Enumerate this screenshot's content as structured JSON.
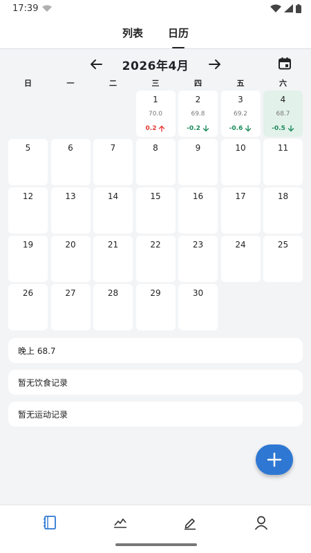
{
  "status_bar": {
    "time": "17:39"
  },
  "tabs": [
    {
      "label": "列表"
    },
    {
      "label": "日历"
    }
  ],
  "month_header": {
    "title": "2026年4月"
  },
  "weekdays": [
    "日",
    "一",
    "二",
    "三",
    "四",
    "五",
    "六"
  ],
  "calendar": {
    "leading_empty": 3,
    "days": [
      {
        "day": "1",
        "weight": "70.0",
        "delta": "0.2",
        "dir": "up"
      },
      {
        "day": "2",
        "weight": "69.8",
        "delta": "-0.2",
        "dir": "down"
      },
      {
        "day": "3",
        "weight": "69.2",
        "delta": "-0.6",
        "dir": "down"
      },
      {
        "day": "4",
        "weight": "68.7",
        "delta": "-0.5",
        "dir": "down",
        "selected": true
      },
      {
        "day": "5"
      },
      {
        "day": "6"
      },
      {
        "day": "7"
      },
      {
        "day": "8"
      },
      {
        "day": "9"
      },
      {
        "day": "10"
      },
      {
        "day": "11"
      },
      {
        "day": "12"
      },
      {
        "day": "13"
      },
      {
        "day": "14"
      },
      {
        "day": "15"
      },
      {
        "day": "16"
      },
      {
        "day": "17"
      },
      {
        "day": "18"
      },
      {
        "day": "19"
      },
      {
        "day": "20"
      },
      {
        "day": "21"
      },
      {
        "day": "22"
      },
      {
        "day": "23"
      },
      {
        "day": "24"
      },
      {
        "day": "25"
      },
      {
        "day": "26"
      },
      {
        "day": "27"
      },
      {
        "day": "28"
      },
      {
        "day": "29"
      },
      {
        "day": "30"
      }
    ]
  },
  "details": {
    "weight_record": "晚上 68.7",
    "diet_record": "暂无饮食记录",
    "exercise_record": "暂无运动记录"
  },
  "colors": {
    "accent": "#2e78d3",
    "selected_day_bg": "#e2f1ea",
    "increase": "#e53935",
    "decrease": "#1a8a5a"
  },
  "icons": {
    "fab": "plus-icon",
    "bottom_nav": [
      "notebook-icon",
      "chart-icon",
      "pencil-icon",
      "profile-icon"
    ]
  }
}
